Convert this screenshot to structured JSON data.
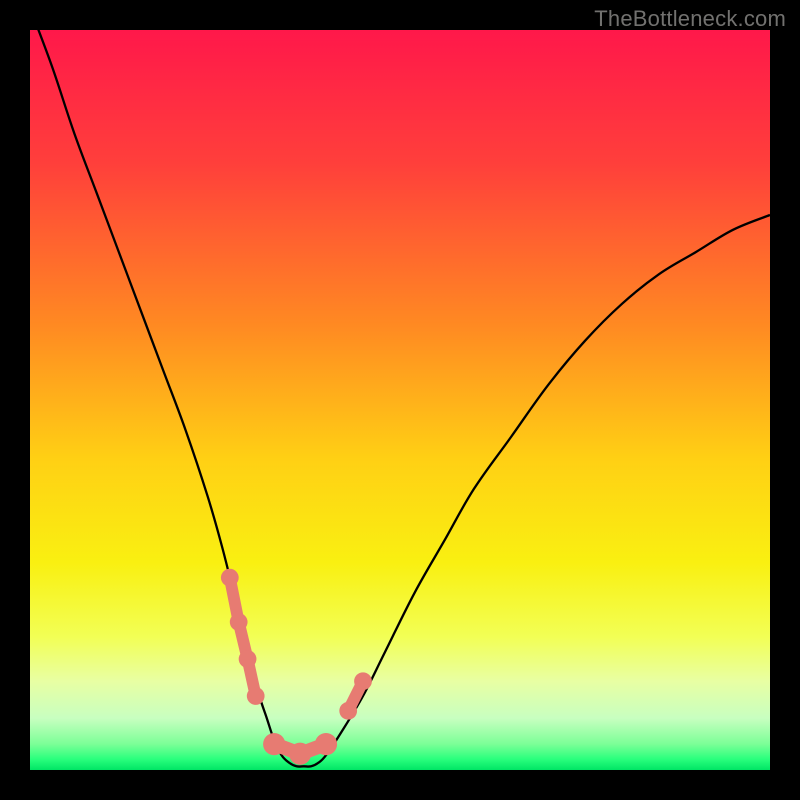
{
  "watermark": "TheBottleneck.com",
  "chart_data": {
    "type": "line",
    "title": "",
    "xlabel": "",
    "ylabel": "",
    "xlim": [
      0,
      100
    ],
    "ylim": [
      0,
      100
    ],
    "grid": false,
    "legend": false,
    "series": [
      {
        "name": "bottleneck-curve",
        "x": [
          0,
          3,
          6,
          9,
          12,
          15,
          18,
          21,
          24,
          26,
          28,
          30,
          31,
          32,
          33,
          34,
          35,
          36,
          37,
          38,
          39,
          40,
          42,
          45,
          48,
          52,
          56,
          60,
          65,
          70,
          75,
          80,
          85,
          90,
          95,
          100
        ],
        "y": [
          103,
          95,
          86,
          78,
          70,
          62,
          54,
          46,
          37,
          30,
          22,
          14,
          10,
          7,
          4,
          2,
          1,
          0.5,
          0.5,
          0.5,
          1,
          2,
          5,
          10,
          16,
          24,
          31,
          38,
          45,
          52,
          58,
          63,
          67,
          70,
          73,
          75
        ]
      }
    ],
    "background_gradient": {
      "stops": [
        {
          "pos": 0.0,
          "color": "#ff184a"
        },
        {
          "pos": 0.18,
          "color": "#ff3f3b"
        },
        {
          "pos": 0.4,
          "color": "#ff8a22"
        },
        {
          "pos": 0.58,
          "color": "#ffd014"
        },
        {
          "pos": 0.72,
          "color": "#f9f011"
        },
        {
          "pos": 0.82,
          "color": "#f2ff55"
        },
        {
          "pos": 0.88,
          "color": "#e8ffa3"
        },
        {
          "pos": 0.93,
          "color": "#c8ffc0"
        },
        {
          "pos": 0.965,
          "color": "#7bff97"
        },
        {
          "pos": 0.985,
          "color": "#2bff7d"
        },
        {
          "pos": 1.0,
          "color": "#00e565"
        }
      ]
    },
    "markers": [
      {
        "name": "left-top-marker",
        "x": 27.0,
        "y": 26,
        "r": 1.2
      },
      {
        "name": "left-upper-marker",
        "x": 28.2,
        "y": 20,
        "r": 1.2
      },
      {
        "name": "left-lower-marker",
        "x": 29.4,
        "y": 15,
        "r": 1.2
      },
      {
        "name": "left-bottom-marker",
        "x": 30.5,
        "y": 10,
        "r": 1.2
      },
      {
        "name": "floor-left-marker",
        "x": 33.0,
        "y": 3.5,
        "r": 1.5
      },
      {
        "name": "floor-mid-marker",
        "x": 36.5,
        "y": 2.2,
        "r": 1.5
      },
      {
        "name": "floor-right-marker",
        "x": 40.0,
        "y": 3.5,
        "r": 1.5
      },
      {
        "name": "right-lower-marker",
        "x": 43.0,
        "y": 8,
        "r": 1.2
      },
      {
        "name": "right-upper-marker",
        "x": 45.0,
        "y": 12,
        "r": 1.2
      }
    ],
    "marker_color": "#e77b72",
    "curve_color": "#000000",
    "curve_width": 2.3
  }
}
